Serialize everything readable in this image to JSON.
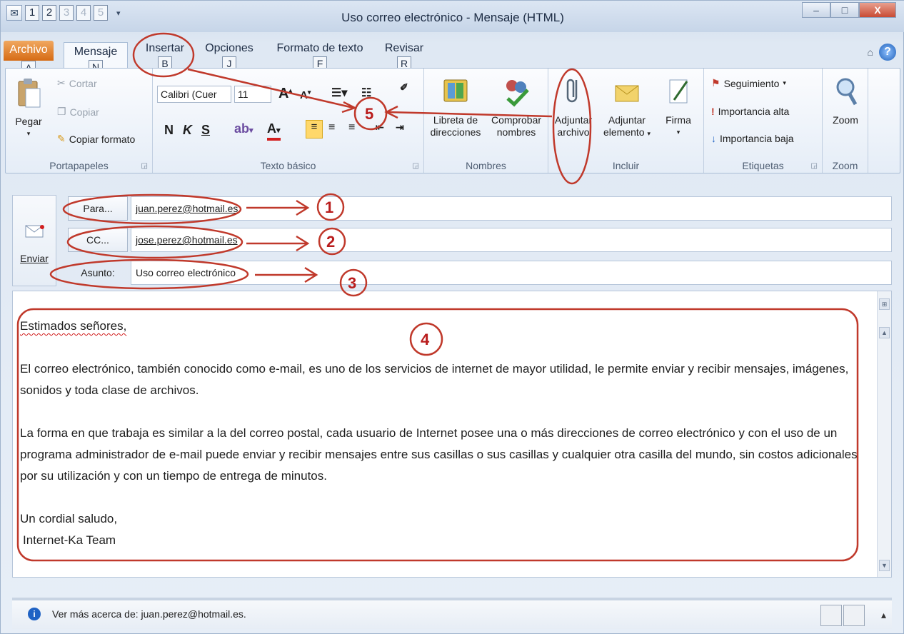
{
  "window": {
    "title": "Uso correo electrónico - Mensaje (HTML)",
    "qat_keytips": [
      "1",
      "2",
      "3",
      "4",
      "5"
    ],
    "minimize_glyph": "–",
    "maximize_glyph": "□",
    "close_glyph": "X"
  },
  "tabs": [
    {
      "label": "Archivo",
      "keytip": "A"
    },
    {
      "label": "Mensaje",
      "keytip": "N"
    },
    {
      "label": "Insertar",
      "keytip": "B"
    },
    {
      "label": "Opciones",
      "keytip": "J"
    },
    {
      "label": "Formato de texto",
      "keytip": "F"
    },
    {
      "label": "Revisar",
      "keytip": "R"
    }
  ],
  "ribbon": {
    "portapapeles": {
      "label": "Portapapeles",
      "paste": "Pegar",
      "cut": "Cortar",
      "copy": "Copiar",
      "format_painter": "Copiar formato"
    },
    "texto_basico": {
      "label": "Texto básico",
      "font": "Calibri (Cuer",
      "size": "11",
      "bold": "N",
      "italic": "K",
      "underline": "S"
    },
    "nombres": {
      "label": "Nombres",
      "address_book": "Libreta de direcciones",
      "check_names": "Comprobar nombres"
    },
    "incluir": {
      "label": "Incluir",
      "attach_file": "Adjuntar archivo",
      "attach_item": "Adjuntar elemento",
      "signature": "Firma"
    },
    "etiquetas": {
      "label": "Etiquetas",
      "follow_up": "Seguimiento",
      "high_importance": "Importancia alta",
      "low_importance": "Importancia baja"
    },
    "zoom": {
      "label": "Zoom",
      "button": "Zoom"
    }
  },
  "header": {
    "send": "Enviar",
    "to_button": "Para...",
    "to_value": "juan.perez@hotmail.es",
    "cc_button": "CC...",
    "cc_value": "jose.perez@hotmail.es",
    "subject_label": "Asunto:",
    "subject_value": "Uso correo electrónico"
  },
  "message": {
    "greeting": "Estimados señores,",
    "paragraph1": "El correo electrónico, también conocido como e-mail, es uno de los servicios de internet de mayor utilidad, le permite enviar y recibir mensajes, imágenes, sonidos y toda clase de archivos.",
    "paragraph2": "La forma en que trabaja es similar a la del correo postal, cada usuario de Internet posee una o más direcciones de correo electrónico y con el uso de un programa administrador de e-mail puede enviar y recibir mensajes entre sus casillas o sus casillas y cualquier otra casilla del mundo, sin costos adicionales por su utilización y con un tiempo de entrega de minutos.",
    "closing": "Un cordial saludo,",
    "signature": "Internet-Ka Team"
  },
  "status": {
    "text": "Ver más acerca de: juan.perez@hotmail.es."
  },
  "annotations": [
    "1",
    "2",
    "3",
    "4",
    "5"
  ],
  "colors": {
    "annotation": "#c0392b",
    "archivo_tab": "#d66b15",
    "ribbon_bg": "#e5edf7"
  }
}
